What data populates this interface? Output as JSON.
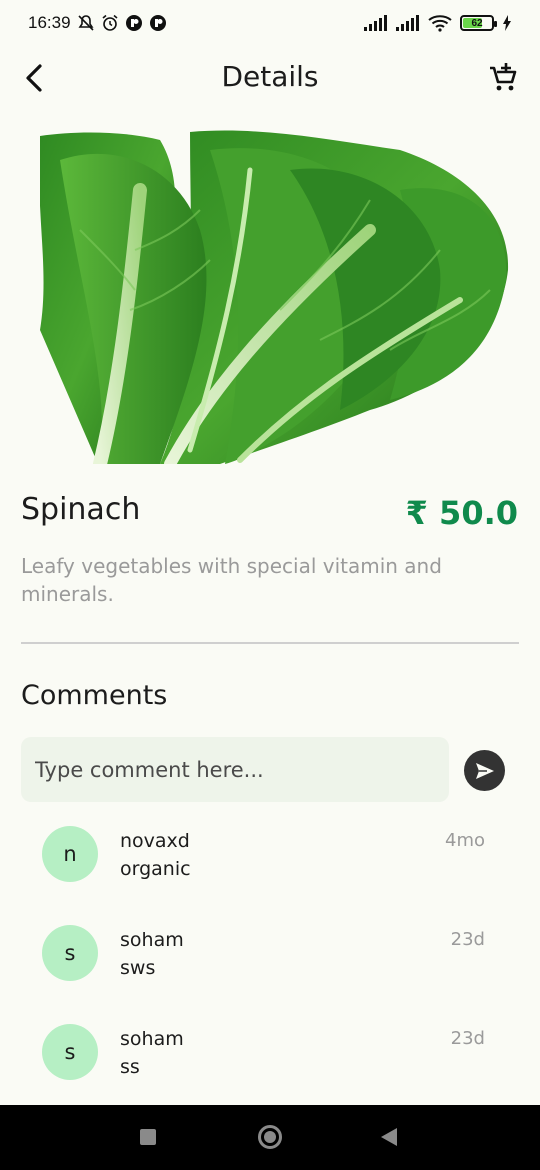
{
  "status_bar": {
    "time": "16:39",
    "battery_level": "62",
    "icons": [
      "mute-icon",
      "alarm-icon",
      "app-icon",
      "app-icon",
      "signal-icon",
      "signal-icon",
      "wifi-icon",
      "battery-icon",
      "charging-icon"
    ]
  },
  "app_bar": {
    "title": "Details",
    "back_icon": "chevron-left-icon",
    "cart_icon": "add-to-cart-icon"
  },
  "product": {
    "name": "Spinach",
    "price": "₹ 50.0",
    "description": "Leafy vegetables with special vitamin and minerals.",
    "image": "leafy-vegetable-image"
  },
  "comments": {
    "title": "Comments",
    "input_placeholder": "Type comment here...",
    "send_icon": "send-icon",
    "items": [
      {
        "initial": "n",
        "user": "novaxd",
        "text": "organic",
        "time": "4mo"
      },
      {
        "initial": "s",
        "user": "soham",
        "text": "sws",
        "time": "23d"
      },
      {
        "initial": "s",
        "user": "soham",
        "text": "ss",
        "time": "23d"
      }
    ]
  },
  "colors": {
    "background": "#fafbf5",
    "price": "#0f8a4c",
    "avatar": "#b6efc4",
    "input_bg": "#eef4ea",
    "send_button": "#333333"
  }
}
